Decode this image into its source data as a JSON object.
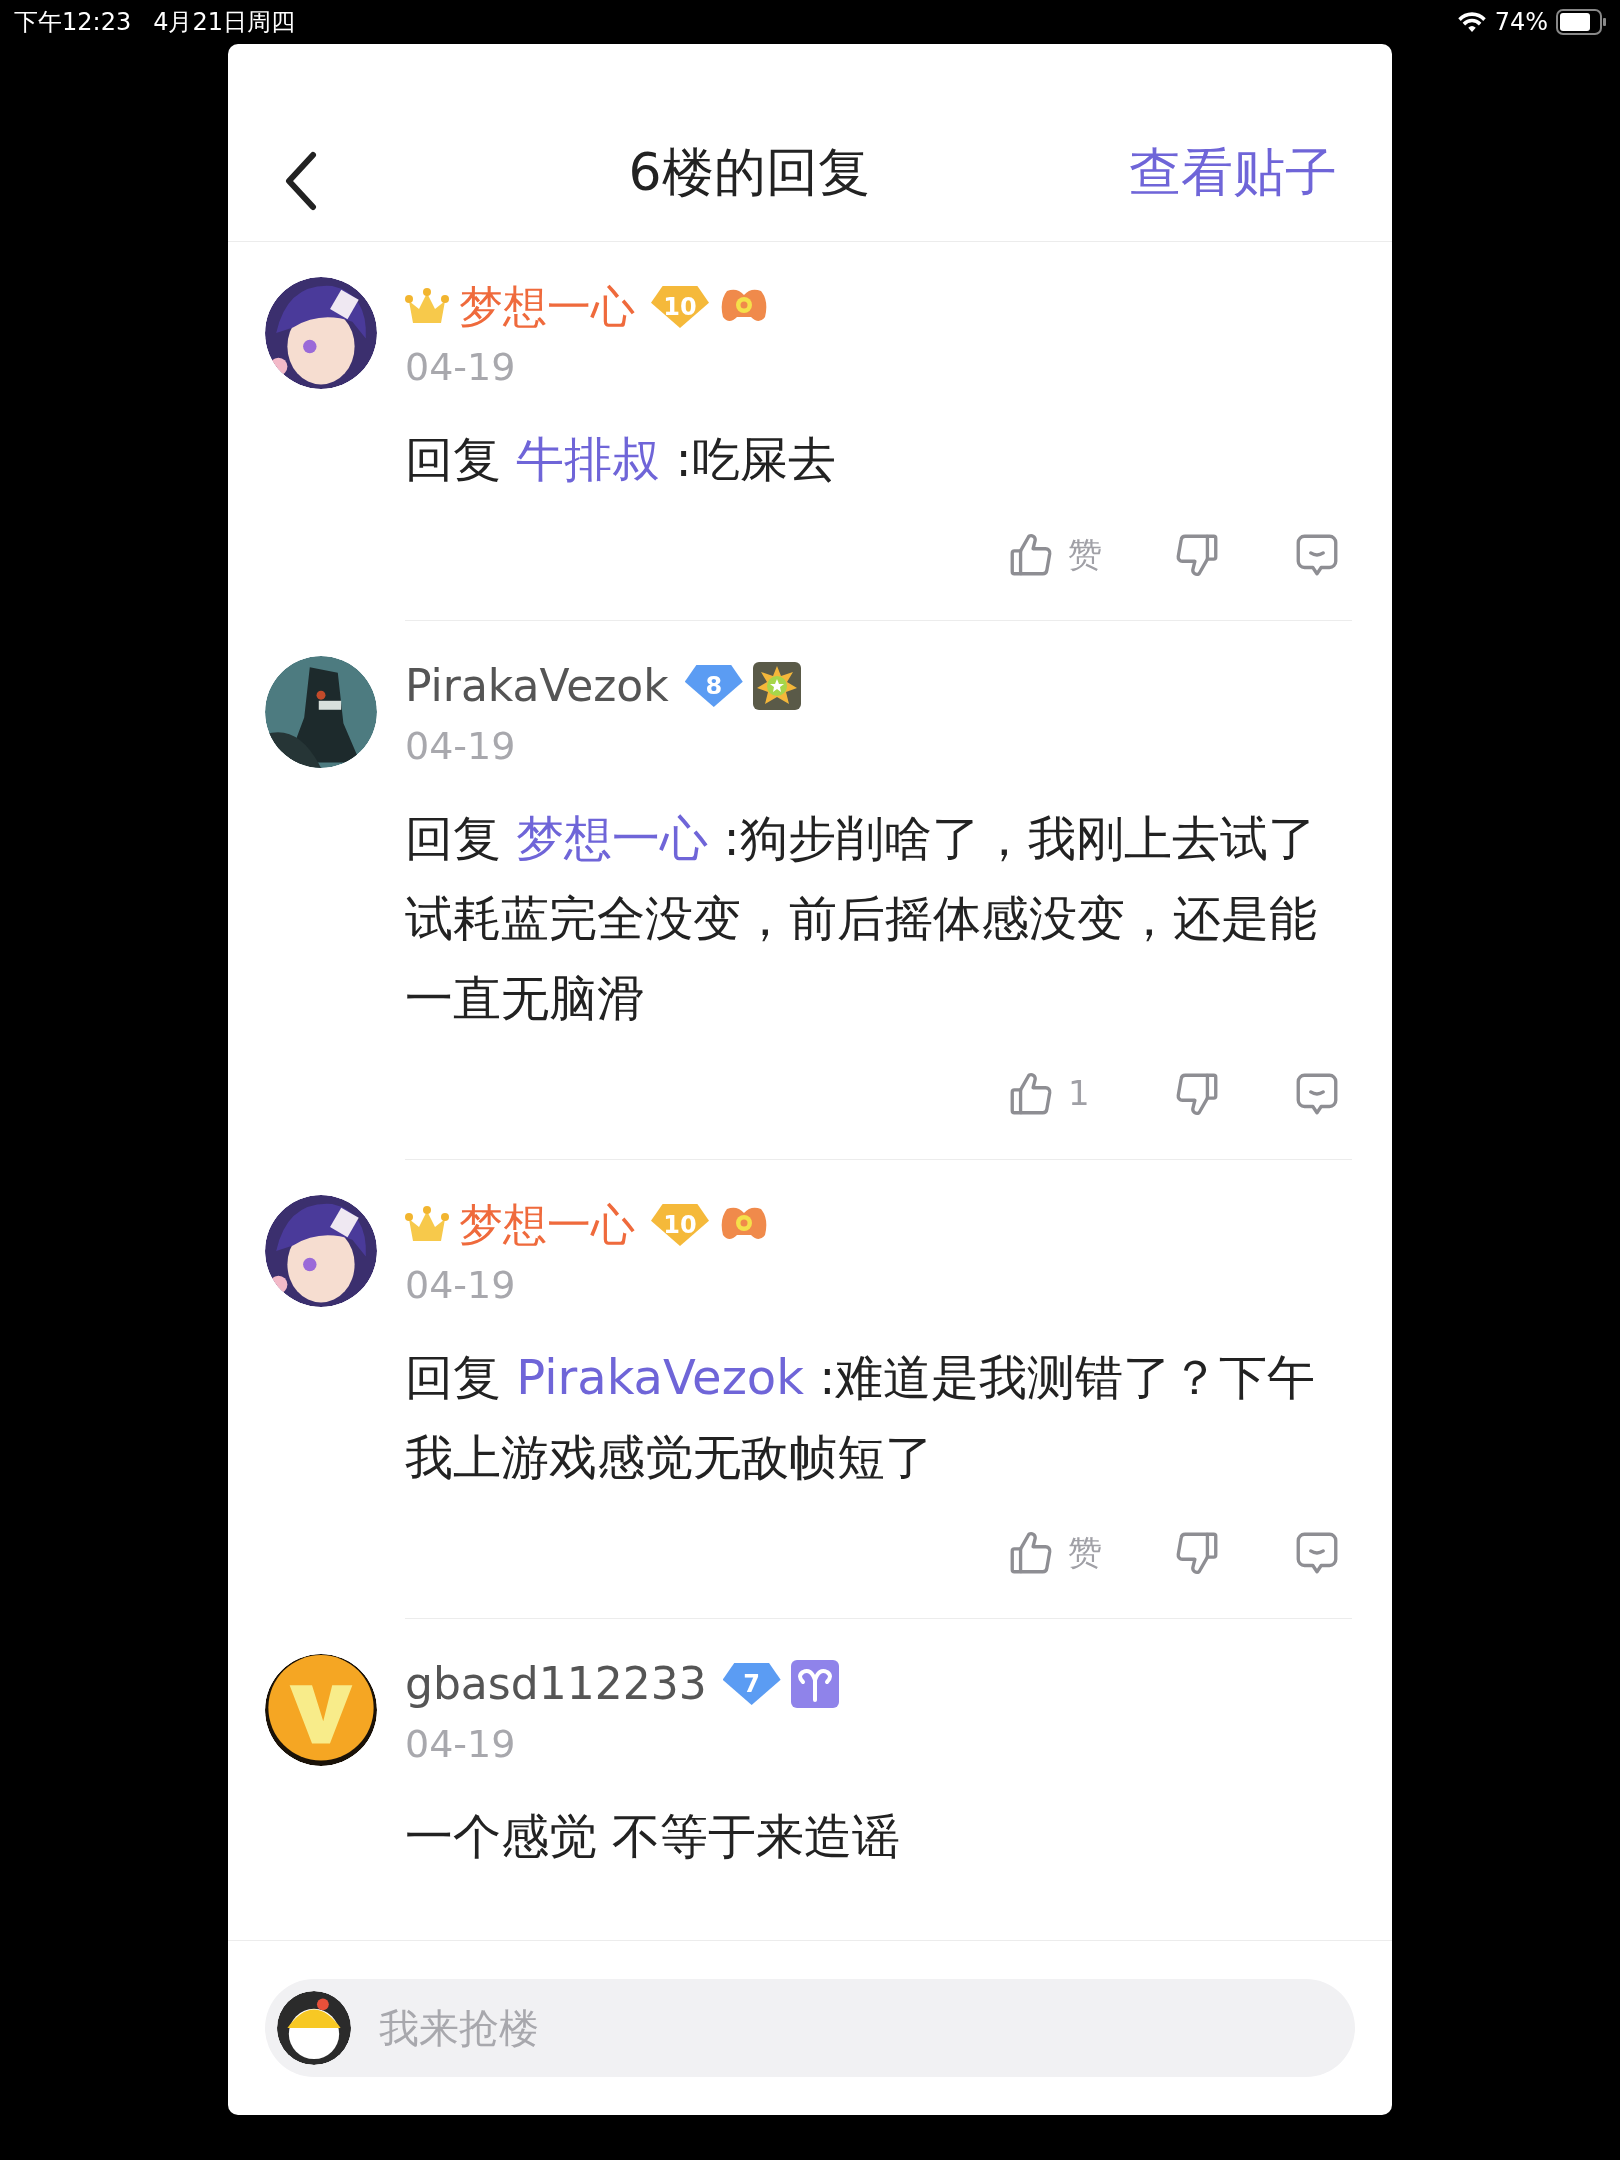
{
  "status_bar": {
    "time": "下午12:23",
    "date": "4月21日周四",
    "battery": "74%"
  },
  "header": {
    "title": "6楼的回复",
    "action": "查看贴子"
  },
  "comments": [
    {
      "avatar": {
        "kind": "anime"
      },
      "user": "梦想一心",
      "vip": true,
      "rank_badge": {
        "text": "10",
        "color": "#f5b93a"
      },
      "badge": {
        "kind": "controller"
      },
      "date": "04-19",
      "reply_prefix": "回复",
      "reply_to": "牛排叔",
      "text": ":吃屎去",
      "like_label": "赞"
    },
    {
      "avatar": {
        "kind": "dark"
      },
      "user": "PirakaVezok",
      "vip": false,
      "rank_badge": {
        "text": "8",
        "color": "#5b9cf3"
      },
      "badge": {
        "kind": "medal"
      },
      "date": "04-19",
      "reply_prefix": "回复",
      "reply_to": "梦想一心",
      "text": ":狗步削啥了，我刚上去试了试耗蓝完全没变，前后摇体感没变，还是能一直无脑滑",
      "like_label": "1"
    },
    {
      "avatar": {
        "kind": "anime"
      },
      "user": "梦想一心",
      "vip": true,
      "rank_badge": {
        "text": "10",
        "color": "#f5b93a"
      },
      "badge": {
        "kind": "controller"
      },
      "date": "04-19",
      "reply_prefix": "回复",
      "reply_to": "PirakaVezok",
      "text": ":难道是我测错了？下午我上游戏感觉无敌帧短了",
      "like_label": "赞"
    },
    {
      "avatar": {
        "kind": "orange"
      },
      "user": "gbasd112233",
      "vip": false,
      "rank_badge": {
        "text": "7",
        "color": "#5b9cf3"
      },
      "badge": {
        "kind": "aries"
      },
      "date": "04-19",
      "text": "一个感觉 不等于来造谣"
    }
  ],
  "composer": {
    "placeholder": "我来抢楼"
  }
}
